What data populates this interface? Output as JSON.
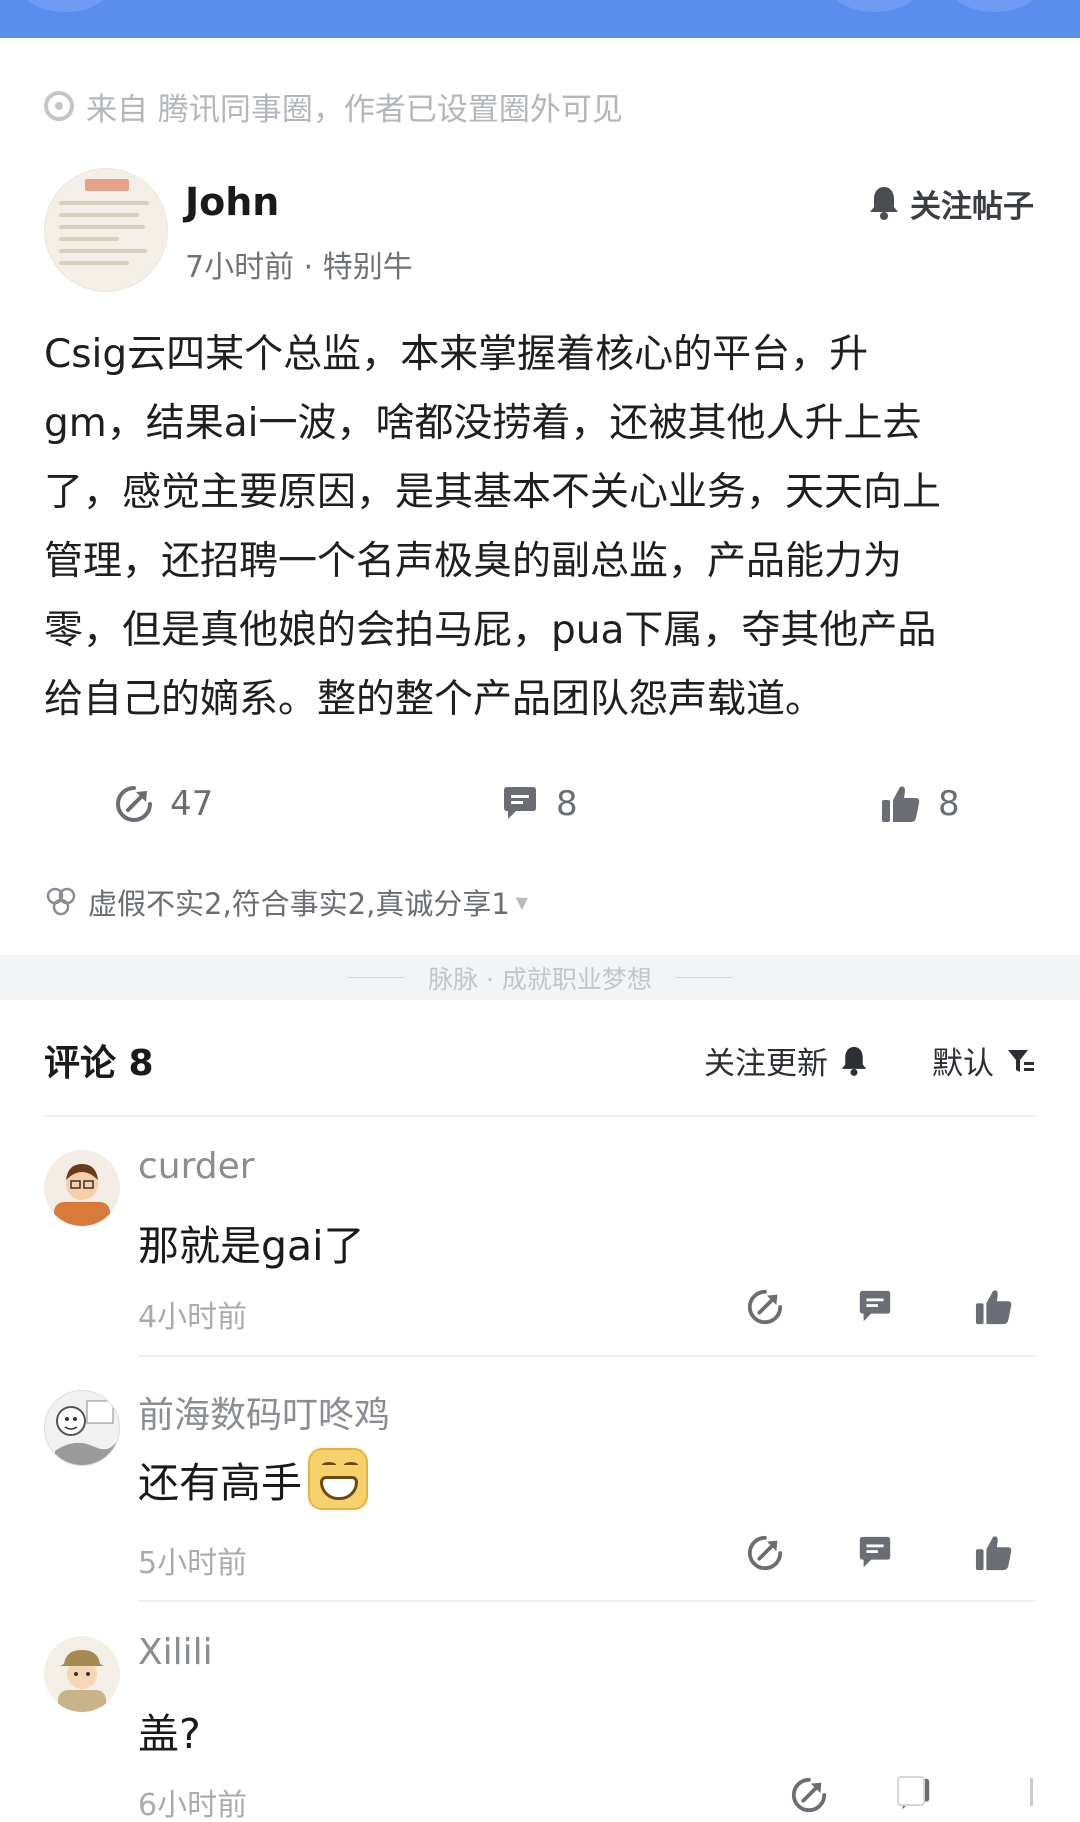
{
  "colors": {
    "accent": "#5b8def",
    "icon_gray": "#6a6e74",
    "muted": "#a8abb0"
  },
  "source": {
    "text": "来自 腾讯同事圈，作者已设置圈外可见"
  },
  "post": {
    "author": "John",
    "meta": "7小时前 · 特别牛",
    "follow_label": "关注帖子",
    "body_lines": [
      "Csig云四某个总监，本来掌握着核心的平台，升",
      "gm，结果ai一波，啥都没捞着，还被其他人升上去",
      "了，感觉主要原因，是其基本不关心业务，天天向上",
      "管理，还招聘一个名声极臭的副总监，产品能力为",
      "零，但是真他娘的会拍马屁，pua下属，夺其他产品",
      "给自己的嫡系。整的整个产品团队怨声载道。"
    ],
    "share_count": "47",
    "comment_count": "8",
    "like_count": "8",
    "reactions": "虚假不实2,符合事实2,真诚分享1"
  },
  "slogan": "脉脉 · 成就职业梦想",
  "comments_header": {
    "title": "评论 8",
    "follow_updates": "关注更新",
    "sort": "默认"
  },
  "comments": [
    {
      "name": "curder",
      "text": "那就是gai了",
      "time": "4小时前"
    },
    {
      "name": "前海数码叮咚鸡",
      "text": "还有高手",
      "time": "5小时前"
    },
    {
      "name": "Xilili",
      "text": "盖?",
      "time": "6小时前"
    }
  ]
}
